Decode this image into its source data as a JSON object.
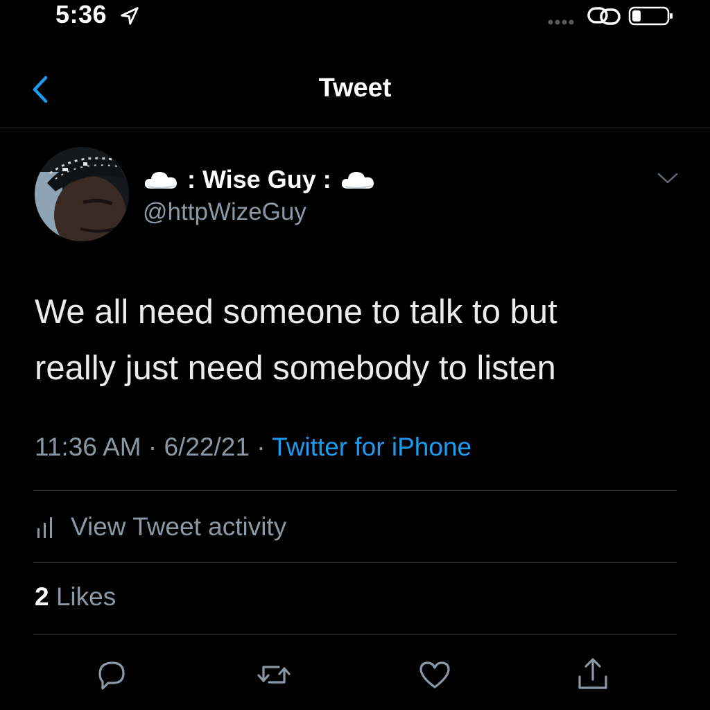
{
  "status_bar": {
    "time": "5:36",
    "icons": [
      "location-arrow-icon",
      "signal-dots-icon",
      "link-icon",
      "battery-icon"
    ]
  },
  "nav": {
    "title": "Tweet",
    "back_icon": "chevron-left-icon"
  },
  "tweet": {
    "author": {
      "name": ": Wise Guy :",
      "handle": "@httpWizeGuy",
      "name_emoji": "cloud-icon"
    },
    "text_lines": [
      "We all need someone to talk to but",
      "really just need somebody to listen"
    ],
    "time": "11:36 AM",
    "separator": " · ",
    "date": "6/22/21",
    "source": "Twitter for iPhone",
    "activity_label": "View Tweet activity",
    "likes_count": "2",
    "likes_label": " Likes"
  },
  "actions": [
    "reply-icon",
    "retweet-icon",
    "like-icon",
    "share-icon"
  ],
  "colors": {
    "background": "#000000",
    "accent": "#1d9bf0",
    "secondary_text": "#8b98a5",
    "primary_text": "#ececec",
    "divider": "#2a2d30"
  }
}
